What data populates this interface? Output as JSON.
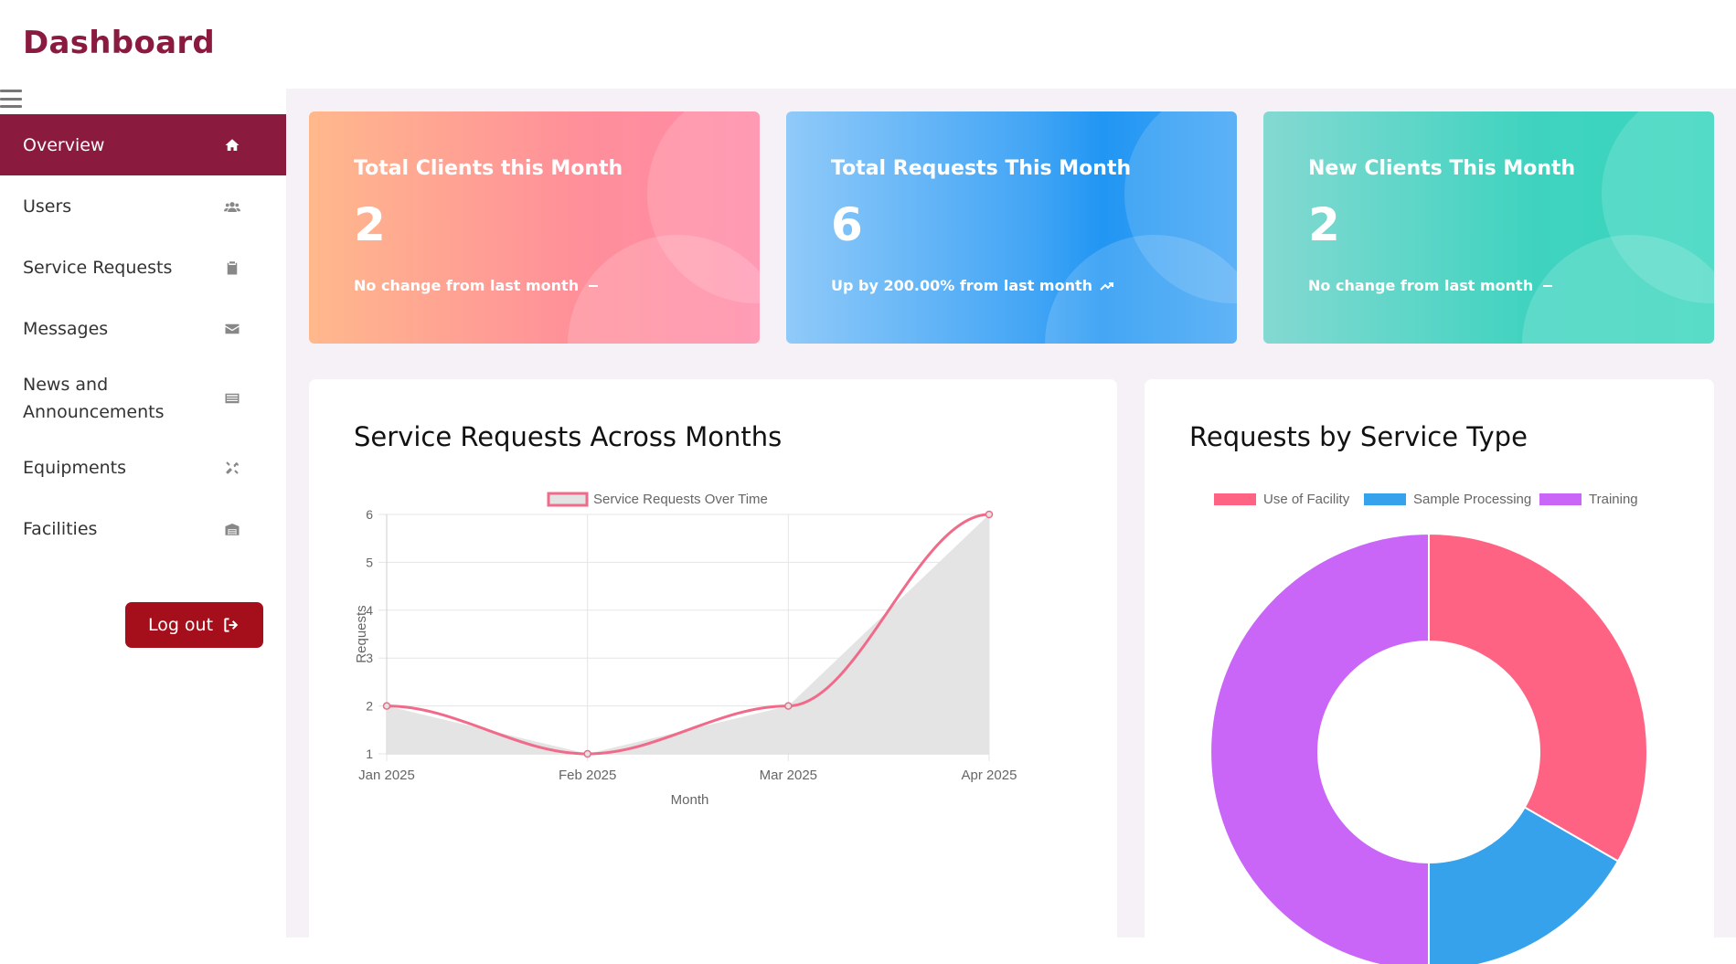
{
  "header": {
    "title": "Dashboard"
  },
  "sidebar": {
    "items": [
      {
        "label": "Overview",
        "icon": "home-icon",
        "active": true
      },
      {
        "label": "Users",
        "icon": "users-icon"
      },
      {
        "label": "Service Requests",
        "icon": "clipboard-icon"
      },
      {
        "label": "Messages",
        "icon": "envelope-icon"
      },
      {
        "label": "News and Announcements",
        "icon": "newspaper-icon"
      },
      {
        "label": "Equipments",
        "icon": "tools-icon"
      },
      {
        "label": "Facilities",
        "icon": "warehouse-icon"
      }
    ],
    "logout_label": "Log out"
  },
  "cards": [
    {
      "title": "Total Clients this Month",
      "value": "2",
      "sub": "No change from last month",
      "trend_icon": "dash-icon"
    },
    {
      "title": "Total Requests This Month",
      "value": "6",
      "sub": "Up by 200.00% from last month",
      "trend_icon": "trending-up-icon"
    },
    {
      "title": "New Clients This Month",
      "value": "2",
      "sub": "No change from last month",
      "trend_icon": "dash-icon"
    }
  ],
  "panels": {
    "line_title": "Service Requests Across Months",
    "donut_title": "Requests by Service Type"
  },
  "colors": {
    "brand": "#8b1a3f",
    "logout": "#a50f1c",
    "line": "#f06b8a",
    "area": "#e3e3e3",
    "use_of_facility": "#ff6384",
    "sample_processing": "#36a2eb",
    "training": "#c966f7"
  },
  "chart_data": [
    {
      "type": "line",
      "title": "",
      "x": [
        "Jan 2025",
        "Feb 2025",
        "Mar 2025",
        "Apr 2025"
      ],
      "series": [
        {
          "name": "Service Requests Over Time",
          "values": [
            2,
            1,
            2,
            6
          ]
        }
      ],
      "xlabel": "Month",
      "ylabel": "Requests",
      "ylim": [
        1,
        6
      ],
      "yticks": [
        1,
        2,
        3,
        4,
        5,
        6
      ],
      "grid": true,
      "legend": "top",
      "filled": true
    },
    {
      "type": "pie",
      "donut": true,
      "categories": [
        "Use of Facility",
        "Sample Processing",
        "Training"
      ],
      "values": [
        2,
        1,
        3
      ],
      "legend": "top"
    }
  ]
}
